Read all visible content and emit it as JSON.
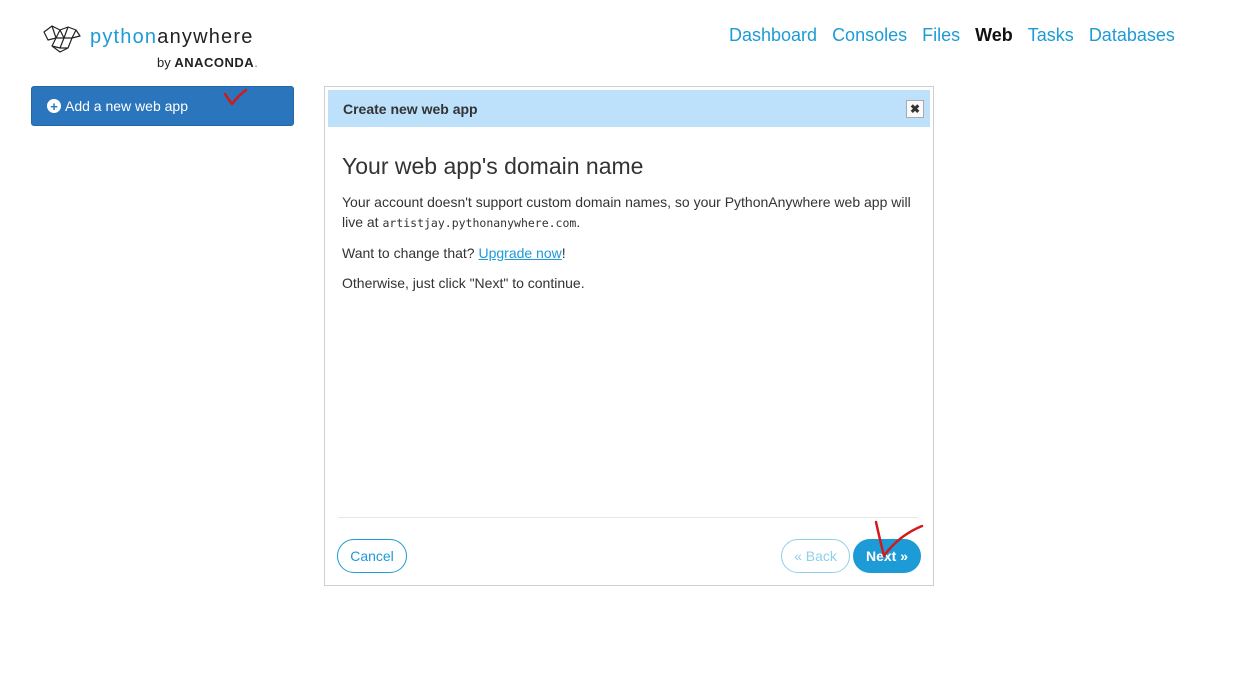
{
  "brand": {
    "name_prefix": "python",
    "name_suffix": "anywhere",
    "by": "by",
    "company": "ANACONDA",
    "company_dot": "."
  },
  "nav": {
    "items": [
      {
        "label": "Dashboard",
        "active": false
      },
      {
        "label": "Consoles",
        "active": false
      },
      {
        "label": "Files",
        "active": false
      },
      {
        "label": "Web",
        "active": true
      },
      {
        "label": "Tasks",
        "active": false
      },
      {
        "label": "Databases",
        "active": false
      }
    ]
  },
  "sidebar": {
    "add_label": "Add a new web app",
    "add_icon": "plus-circle-icon"
  },
  "modal": {
    "title": "Create new web app",
    "close_icon": "close-icon",
    "heading": "Your web app's domain name",
    "para1_text": "Your account doesn't support custom domain names, so your PythonAnywhere web app will live at ",
    "para1_domain": "artistjay.pythonanywhere.com",
    "para1_end": ".",
    "para2_text": "Want to change that? ",
    "para2_link": "Upgrade now",
    "para2_end": "!",
    "para3": "Otherwise, just click \"Next\" to continue.",
    "cancel_label": "Cancel",
    "back_label": "« Back",
    "next_label": "Next »"
  },
  "colors": {
    "accent": "#1d9bd6",
    "primary_button": "#2a75bb",
    "header_bg": "#bde0fb",
    "annotation": "#d11a1a"
  }
}
